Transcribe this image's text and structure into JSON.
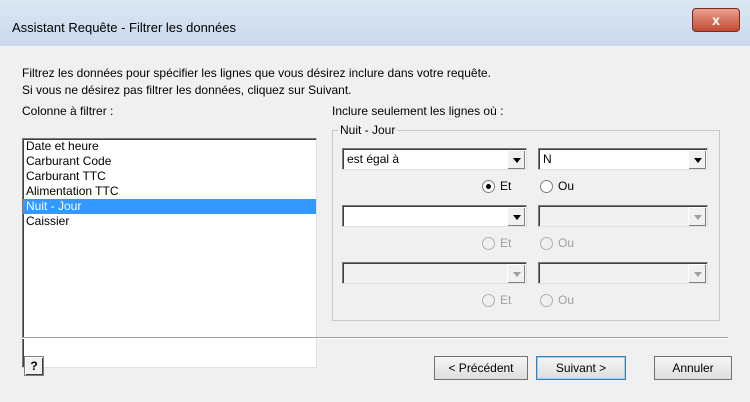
{
  "window": {
    "title": "Assistant Requête - Filtrer les données"
  },
  "intro": {
    "line1": "Filtrez les données pour spécifier les lignes que vous désirez inclure dans votre requête.",
    "line2": "Si vous ne désirez pas filtrer les données, cliquez sur Suivant."
  },
  "columns": {
    "label": "Colonne à filtrer :",
    "items": [
      "Date et heure",
      "Carburant Code",
      "Carburant TTC",
      "Alimentation TTC",
      "Nuit - Jour",
      "Caissier"
    ],
    "selected": "Nuit - Jour"
  },
  "filter": {
    "label": "Inclure seulement les lignes où :",
    "group_title": "Nuit - Jour",
    "row1": {
      "operator": "est égal à",
      "value": "N"
    },
    "row2": {
      "operator": "",
      "value": ""
    },
    "row3": {
      "operator": "",
      "value": ""
    },
    "logic1": {
      "et": "Et",
      "ou": "Ou",
      "selected": "Et"
    },
    "logic2": {
      "et": "Et",
      "ou": "Ou"
    },
    "logic3": {
      "et": "Et",
      "ou": "Ou"
    }
  },
  "buttons": {
    "help": "?",
    "previous": "< Précédent",
    "next": "Suivant >",
    "cancel": "Annuler",
    "close": "x"
  }
}
